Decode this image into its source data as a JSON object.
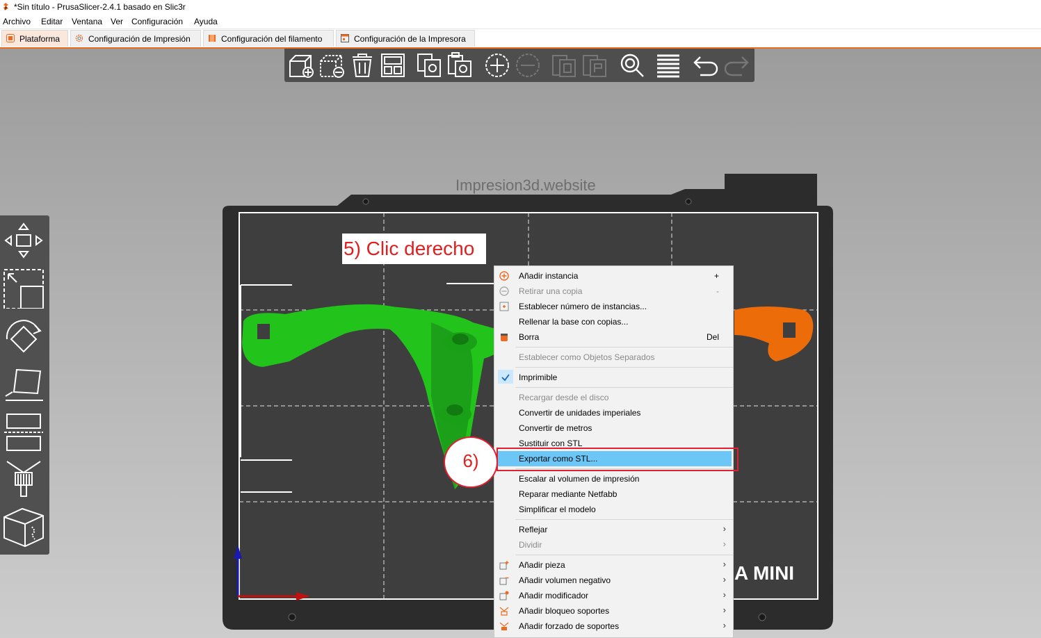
{
  "window": {
    "title": "*Sin título - PrusaSlicer-2.4.1 basado en Slic3r"
  },
  "menu": [
    "Archivo",
    "Editar",
    "Ventana",
    "Ver",
    "Configuración",
    "Ayuda"
  ],
  "tabs": [
    {
      "label": "Plataforma",
      "active": true
    },
    {
      "label": "Configuración de Impresión",
      "active": false
    },
    {
      "label": "Configuración del filamento",
      "active": false
    },
    {
      "label": "Configuración de la Impresora",
      "active": false
    }
  ],
  "top_toolbar": [
    "add-object-icon",
    "delete-object-icon",
    "delete-all-icon",
    "arrange-icon",
    "copy-icon",
    "paste-icon",
    "add-instance-icon",
    "remove-instance-icon",
    "split-objects-icon",
    "split-parts-icon",
    "search-icon",
    "layers-icon",
    "undo-icon",
    "redo-icon"
  ],
  "left_toolbar": [
    "move-icon",
    "scale-icon",
    "rotate-icon",
    "place-on-face-icon",
    "cut-icon",
    "paint-supports-icon",
    "seam-painting-icon"
  ],
  "watermark": "Impresion3d.website",
  "bed_label": "A MINI",
  "annotations": {
    "step5": "5) Clic derecho",
    "step6": "6)"
  },
  "context_menu": {
    "items": [
      {
        "label": "Añadir instancia",
        "shortcut": "+",
        "icon": "add-instance-icon"
      },
      {
        "label": "Retirar una copia",
        "shortcut": "-",
        "icon": "remove-copy-icon",
        "disabled": true
      },
      {
        "label": "Establecer número de instancias...",
        "icon": "set-instances-icon"
      },
      {
        "label": "Rellenar la base con copias..."
      },
      {
        "label": "Borra",
        "shortcut": "Del",
        "icon": "delete-icon"
      },
      {
        "label": "Establecer como Objetos Separados",
        "disabled": true
      },
      {
        "label": "Imprimible",
        "checked": true
      },
      {
        "label": "Recargar desde el disco",
        "disabled": true
      },
      {
        "label": "Convertir de unidades imperiales"
      },
      {
        "label": "Convertir de metros"
      },
      {
        "label": "Sustituir con STL"
      },
      {
        "label": "Exportar como STL...",
        "highlighted": true
      },
      {
        "label": "Escalar al volumen de impresión"
      },
      {
        "label": "Reparar mediante Netfabb"
      },
      {
        "label": "Simplificar el modelo"
      },
      {
        "label": "Reflejar",
        "submenu": true
      },
      {
        "label": "Dividir",
        "submenu": true,
        "disabled": true
      },
      {
        "label": "Añadir pieza",
        "submenu": true,
        "icon": "add-part-icon"
      },
      {
        "label": "Añadir volumen negativo",
        "submenu": true,
        "icon": "add-negative-volume-icon"
      },
      {
        "label": "Añadir modificador",
        "submenu": true,
        "icon": "add-modifier-icon"
      },
      {
        "label": "Añadir bloqueo soportes",
        "submenu": true,
        "icon": "add-support-blocker-icon"
      },
      {
        "label": "Añadir forzado de soportes",
        "submenu": true,
        "icon": "add-support-enforcer-icon"
      }
    ],
    "submenu_glyph": "›"
  },
  "colors": {
    "accent": "#ed6b21",
    "selected_object": "#22c41c",
    "other_object": "#ec6c0a",
    "highlight": "#6cc7f6",
    "annotation": "#e02020"
  }
}
